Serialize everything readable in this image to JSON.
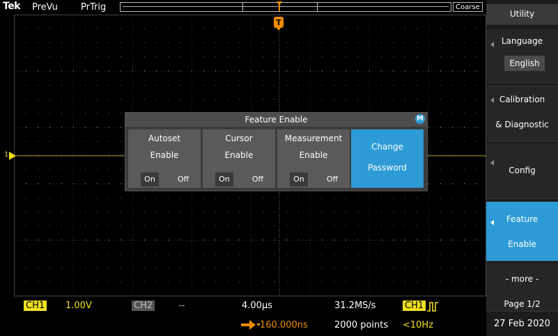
{
  "topbar": {
    "brand": "Tek",
    "mode1": "PreVu",
    "mode2": "PrTrig",
    "resolution": "Coarse"
  },
  "dialog": {
    "title": "Feature Enable",
    "badge": "M",
    "features": [
      {
        "line1": "Autoset",
        "line2": "Enable",
        "on": "On",
        "off": "Off"
      },
      {
        "line1": "Cursor",
        "line2": "Enable",
        "on": "On",
        "off": "Off"
      },
      {
        "line1": "Measurement",
        "line2": "Enable",
        "on": "On",
        "off": "Off"
      }
    ],
    "change_password": {
      "line1": "Change",
      "line2": "Password"
    }
  },
  "menu": {
    "title": "Utility",
    "language": {
      "label": "Language",
      "value": "English"
    },
    "calibration": {
      "line1": "Calibration",
      "line2": "& Diagnostic"
    },
    "config": "Config",
    "feature_enable": {
      "line1": "Feature",
      "line2": "Enable"
    },
    "more": {
      "line1": "- more -",
      "line2": "Page 1/2"
    },
    "date": "27 Feb 2020"
  },
  "status": {
    "ch1": "CH1",
    "ch1_scale": "1.00V",
    "ch2": "CH2",
    "ch2_scale": "--",
    "timebase": "4.00µs",
    "delay": "160.000ns",
    "sample_rate": "31.2MS/s",
    "record_length": "2000 points",
    "trigger_source": "CH1",
    "trigger_freq": "<10Hz"
  },
  "markers": {
    "ch1_marker": "1",
    "trigger_marker": "T"
  },
  "colors": {
    "accent": "#2d9bd6",
    "ch1": "#f0e020",
    "trigger": "#f08c00"
  }
}
